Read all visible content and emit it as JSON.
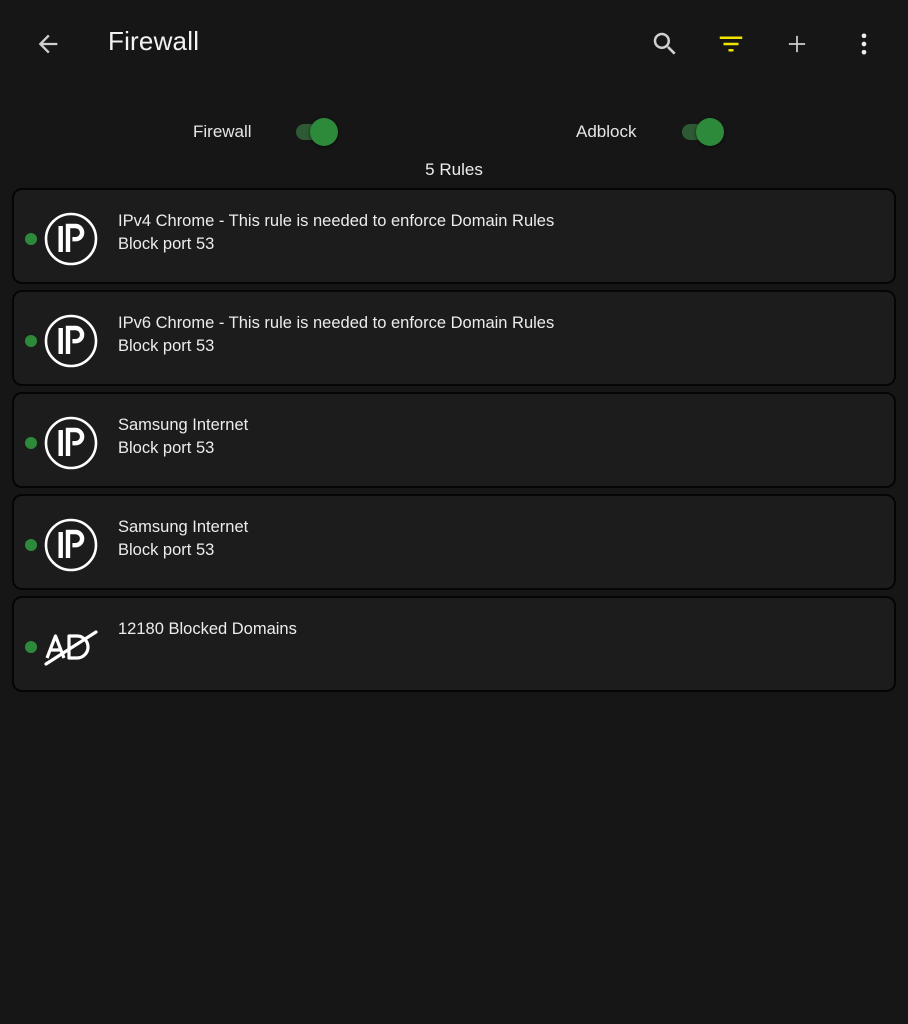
{
  "toolbar": {
    "title": "Firewall",
    "back_icon": "arrow-back-icon",
    "actions": [
      "search-icon",
      "filter-icon",
      "add-icon",
      "more-vert-icon"
    ],
    "filter_color": "#f2e600"
  },
  "toggles": {
    "firewall": {
      "label": "Firewall",
      "enabled": true
    },
    "adblock": {
      "label": "Adblock",
      "enabled": true
    }
  },
  "accent_color": "#2e8a3b",
  "rules_count": "5 Rules",
  "rules": [
    {
      "type": "ip",
      "title": "IPv4 Chrome - This rule is needed to enforce Domain Rules",
      "subtitle": "Block port 53",
      "active": true
    },
    {
      "type": "ip",
      "title": "IPv6 Chrome - This rule is needed to enforce Domain Rules",
      "subtitle": "Block port 53",
      "active": true
    },
    {
      "type": "ip",
      "title": "Samsung Internet",
      "subtitle": "Block port 53",
      "active": true
    },
    {
      "type": "ip",
      "title": "Samsung Internet",
      "subtitle": "Block port 53",
      "active": true
    },
    {
      "type": "ad",
      "title": "12180 Blocked Domains",
      "subtitle": "",
      "active": true
    }
  ]
}
